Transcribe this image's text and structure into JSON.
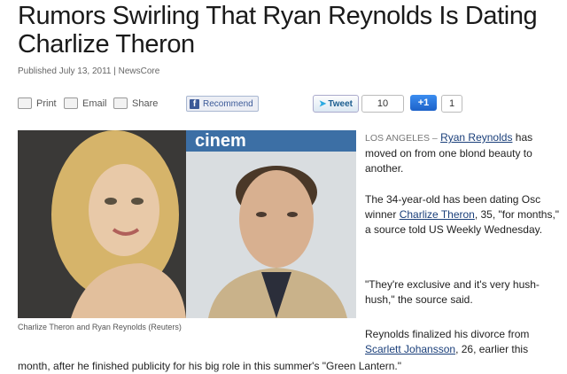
{
  "headline": "Rumors Swirling That Ryan Reynolds Is Dating Charlize Theron",
  "published": "Published July 13, 2011 | NewsCore",
  "toolbar": {
    "print": "Print",
    "email": "Email",
    "share": "Share",
    "recommend": "Recommend",
    "tweet": "Tweet",
    "tweet_count": "10",
    "plus_one": "+1",
    "plus_one_count": "1"
  },
  "photo_caption": "Charlize Theron and Ryan Reynolds (Reuters)",
  "article": {
    "dateline": "LOS ANGELES –",
    "p1_link": "Ryan Reynolds",
    "p1_rest": " has moved on from one blond beauty to another.",
    "p2_a": "The 34-year-old has been dating Osc",
    "p2_b": "winner ",
    "p2_link": "Charlize Theron",
    "p2_c": ", 35, \"for months,\" a source told US Weekly Wednesday.",
    "p3": "\"They're exclusive and it's very hush-hush,\" the source said.",
    "p4_a": "Reynolds finalized his divorce from",
    "p4_link": "Scarlett Johansson",
    "p4_b": ", 26, earlier this",
    "p4_bottom": "month, after he finished publicity for his big role in this summer's \"Green Lantern.\""
  },
  "colors": {
    "link": "#1a3f7a",
    "facebook": "#3b5998",
    "google_plus": "#2a74dc"
  }
}
